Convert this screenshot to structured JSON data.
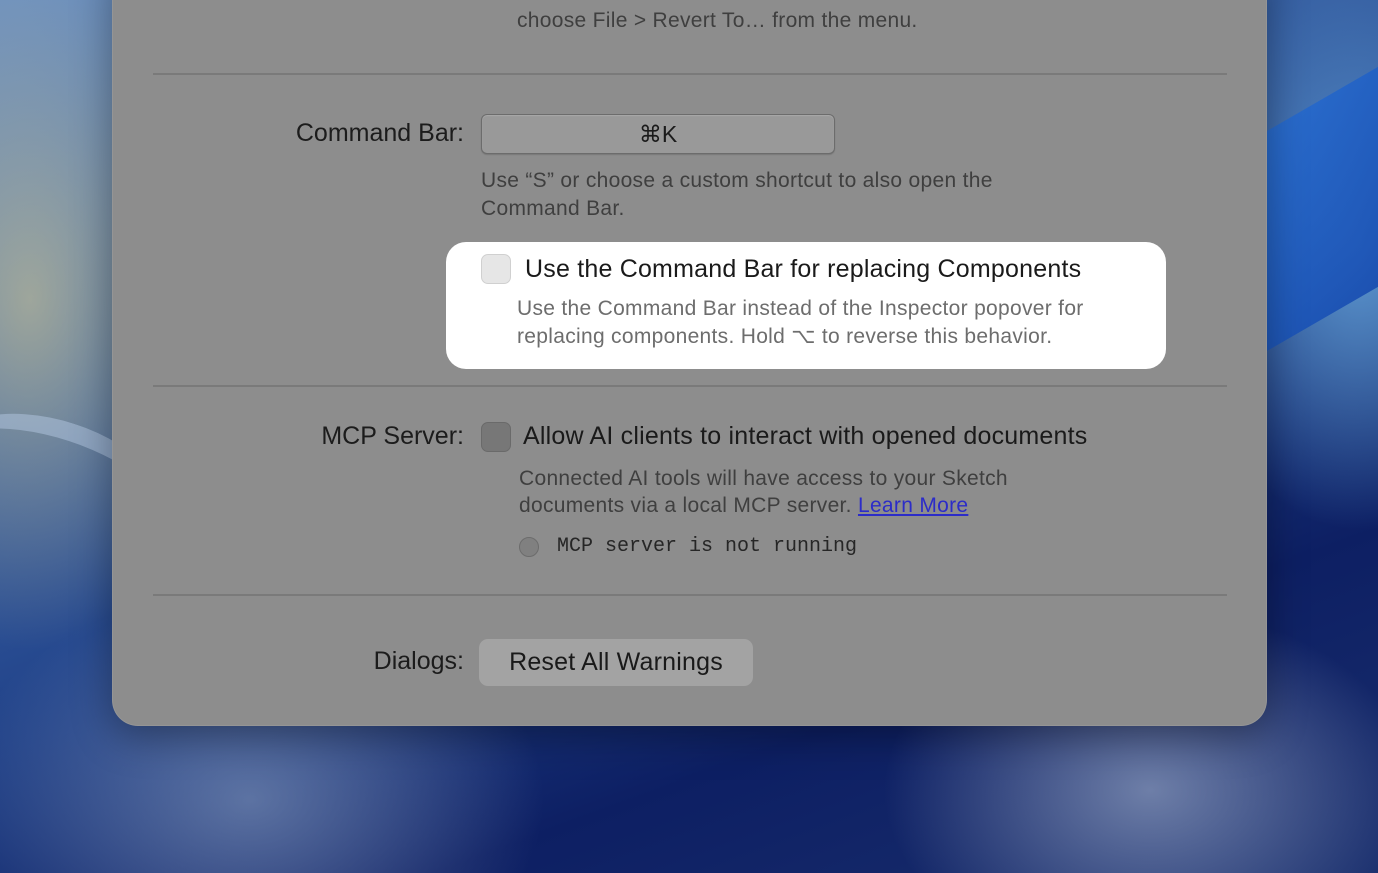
{
  "window": {
    "top_help_line": "choose File > Revert To… from the menu."
  },
  "command_bar": {
    "label": "Command Bar:",
    "shortcut_value": "⌘K",
    "help_line1": "Use “S” or choose a custom shortcut to also open the",
    "help_line2": "Command Bar.",
    "replace_components_label": "Use the Command Bar for replacing Components",
    "replace_components_checked": false,
    "replace_help_line1": "Use the Command Bar instead of the Inspector popover for",
    "replace_help_line2": "replacing components. Hold ⌥ to reverse this behavior."
  },
  "mcp_server": {
    "label": "MCP Server:",
    "allow_label": "Allow AI clients to interact with opened documents",
    "allow_checked": false,
    "help_line1": "Connected AI tools will have access to your Sketch",
    "help_line2_prefix": "documents via a local MCP server.",
    "learn_more": "Learn More",
    "status_text": "MCP server is not running",
    "status_color": "#808080"
  },
  "dialogs": {
    "label": "Dialogs:",
    "reset_button": "Reset All Warnings"
  },
  "colors": {
    "window_bg": "#8d8d8d",
    "highlight_card_bg": "#ffffff",
    "link": "#2c2cc8"
  }
}
